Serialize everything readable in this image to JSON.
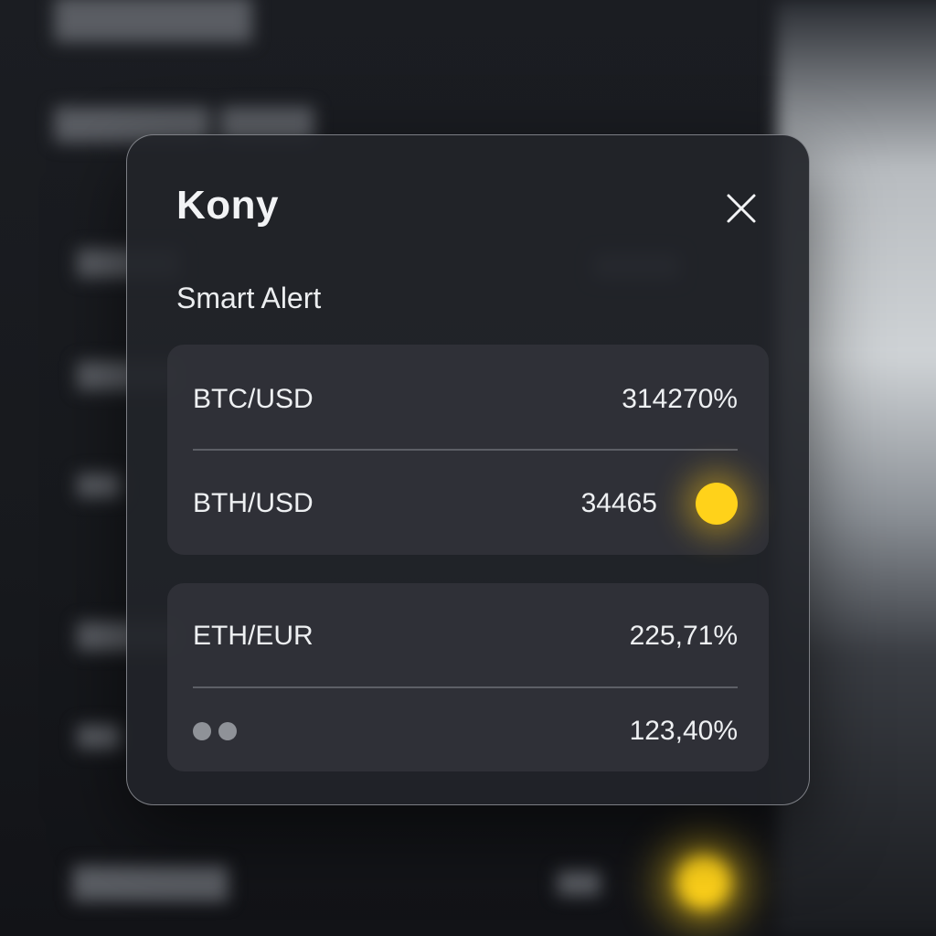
{
  "modal": {
    "title": "Kony",
    "subtitle": "Smart Alert",
    "close_icon": "close-icon"
  },
  "groups": [
    {
      "rows": [
        {
          "label": "BTC/USD",
          "value": "314270%"
        },
        {
          "label": "BTH/USD",
          "value": "34465",
          "indicator": "yellow-dot",
          "indicator_color": "#ffd21a"
        }
      ]
    },
    {
      "rows": [
        {
          "label": "ETH/EUR",
          "value": "225,71%"
        },
        {
          "label_icon": "dots-icon",
          "value": "123,40%"
        }
      ]
    }
  ],
  "colors": {
    "accent": "#ffd21a",
    "modal_bg": "#222429",
    "text": "#eef0f2"
  }
}
